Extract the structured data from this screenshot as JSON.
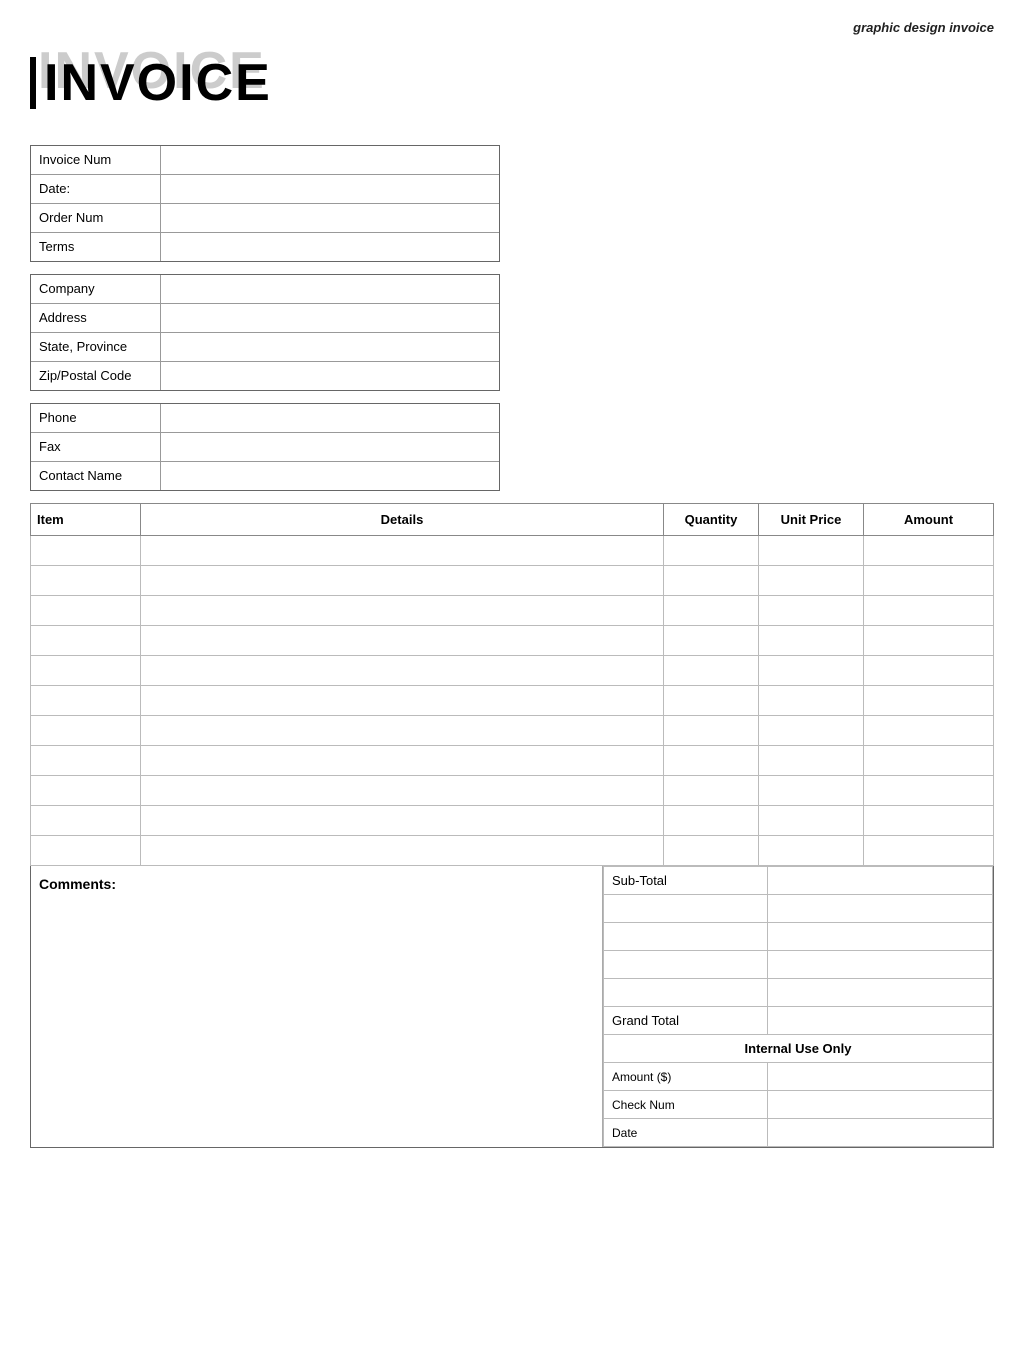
{
  "header": {
    "title": "graphic design invoice"
  },
  "invoice_title": {
    "shadow": "INVOICE",
    "main": "INVOICE"
  },
  "invoice_info": {
    "rows": [
      {
        "label": "Invoice Num",
        "value": ""
      },
      {
        "label": "Date:",
        "value": ""
      },
      {
        "label": "Order Num",
        "value": ""
      },
      {
        "label": "Terms",
        "value": ""
      }
    ]
  },
  "company_info": {
    "rows": [
      {
        "label": "Company",
        "value": ""
      },
      {
        "label": "Address",
        "value": ""
      },
      {
        "label": "State, Province",
        "value": ""
      },
      {
        "label": "Zip/Postal Code",
        "value": ""
      }
    ]
  },
  "contact_info": {
    "rows": [
      {
        "label": "Phone",
        "value": ""
      },
      {
        "label": "Fax",
        "value": ""
      },
      {
        "label": "Contact Name",
        "value": ""
      }
    ]
  },
  "items_table": {
    "headers": [
      "Item",
      "Details",
      "Quantity",
      "Unit Price",
      "Amount"
    ],
    "rows": [
      [
        "",
        "",
        "",
        "",
        ""
      ],
      [
        "",
        "",
        "",
        "",
        ""
      ],
      [
        "",
        "",
        "",
        "",
        ""
      ],
      [
        "",
        "",
        "",
        "",
        ""
      ],
      [
        "",
        "",
        "",
        "",
        ""
      ],
      [
        "",
        "",
        "",
        "",
        ""
      ],
      [
        "",
        "",
        "",
        "",
        ""
      ],
      [
        "",
        "",
        "",
        "",
        ""
      ],
      [
        "",
        "",
        "",
        "",
        ""
      ],
      [
        "",
        "",
        "",
        "",
        ""
      ],
      [
        "",
        "",
        "",
        "",
        ""
      ]
    ]
  },
  "comments": {
    "label": "Comments:"
  },
  "totals": {
    "subtotal_label": "Sub-Total",
    "subtotal_value": "",
    "extra_rows": [
      "",
      "",
      "",
      ""
    ],
    "grand_total_label": "Grand Total",
    "grand_total_value": "",
    "internal_use_label": "Internal Use Only",
    "internal_rows": [
      {
        "label": "Amount ($)",
        "value": ""
      },
      {
        "label": "Check Num",
        "value": ""
      },
      {
        "label": "Date",
        "value": ""
      }
    ]
  }
}
